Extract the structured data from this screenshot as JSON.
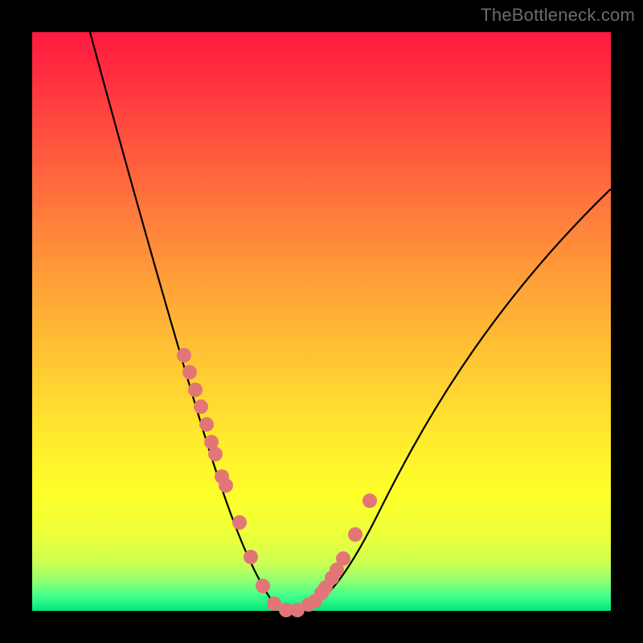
{
  "watermark": {
    "text": "TheBottleneck.com"
  },
  "chart_data": {
    "type": "line",
    "title": "",
    "xlabel": "",
    "ylabel": "",
    "xlim": [
      0,
      100
    ],
    "ylim": [
      0,
      100
    ],
    "grid": false,
    "legend": false,
    "series": [
      {
        "name": "bottleneck-curve",
        "x": [
          10,
          14,
          18,
          22,
          26,
          30,
          32,
          34,
          36,
          38,
          40,
          42,
          44,
          46,
          50,
          55,
          60,
          65,
          70,
          75,
          80,
          85,
          90,
          95,
          100
        ],
        "y": [
          100,
          86,
          73,
          60,
          48,
          36,
          30,
          24,
          18,
          12,
          6,
          2,
          0,
          0,
          2,
          7,
          14,
          22,
          31,
          40,
          49,
          57,
          64,
          69,
          73
        ]
      },
      {
        "name": "highlight-dots",
        "x": [
          26.5,
          27.5,
          28.5,
          29.5,
          30.5,
          31.2,
          32.0,
          33.2,
          33.8,
          36.0,
          38.0,
          40.0,
          42.0,
          44.0,
          46.0,
          48.0,
          49.0,
          50.2,
          50.8,
          52.0,
          52.8,
          54.0,
          56.0,
          58.5
        ],
        "y": [
          44.0,
          41.0,
          38.0,
          35.0,
          32.0,
          29.0,
          27.0,
          23.0,
          21.5,
          15.0,
          9.0,
          4.0,
          1.0,
          0.0,
          0.0,
          1.0,
          1.5,
          3.0,
          4.0,
          5.5,
          7.0,
          9.0,
          13.0,
          19.0
        ]
      }
    ],
    "colors": {
      "curve": "#000000",
      "dots": "#e27676",
      "gradient_top": "#ff1a3f",
      "gradient_mid": "#ffd633",
      "gradient_bottom": "#00e87a"
    }
  }
}
